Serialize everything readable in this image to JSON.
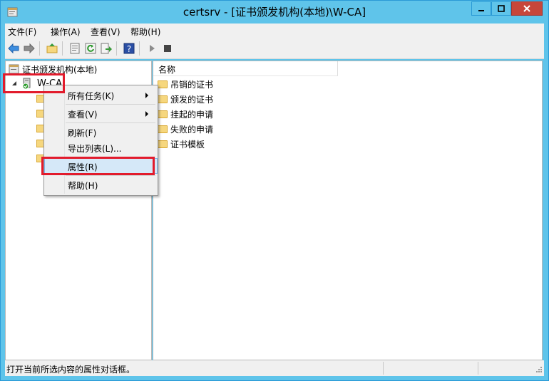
{
  "window": {
    "title": "certsrv - [证书颁发机构(本地)\\W-CA]"
  },
  "menubar": {
    "items": [
      "文件(F)",
      "操作(A)",
      "查看(V)",
      "帮助(H)"
    ]
  },
  "toolbar": {
    "icons": [
      "back-arrow-icon",
      "forward-arrow-icon",
      "up-folder-icon",
      "properties-icon",
      "refresh-icon",
      "export-list-icon",
      "help-icon",
      "start-service-icon",
      "stop-service-icon"
    ]
  },
  "tree": {
    "root_label": "证书颁发机构(本地)",
    "ca_label": "W-CA"
  },
  "list": {
    "column_name": "名称",
    "items": [
      "吊销的证书",
      "颁发的证书",
      "挂起的申请",
      "失败的申请",
      "证书模板"
    ]
  },
  "context_menu": {
    "items": [
      "所有任务(K)",
      "查看(V)",
      "刷新(F)",
      "导出列表(L)...",
      "属性(R)",
      "帮助(H)"
    ]
  },
  "status": {
    "text": "打开当前所选内容的属性对话框。"
  },
  "colors": {
    "titlebar": "#5fc4ea",
    "highlight_box": "#e21b2c",
    "close_button": "#c7463a"
  }
}
